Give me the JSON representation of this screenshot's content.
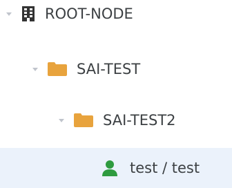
{
  "tree": {
    "nodes": [
      {
        "label": "ROOT-NODE",
        "icon": "building-icon",
        "expanded": true,
        "level": 0
      },
      {
        "label": "SAI-TEST",
        "icon": "folder-icon",
        "expanded": true,
        "level": 1
      },
      {
        "label": "SAI-TEST2",
        "icon": "folder-icon",
        "expanded": true,
        "level": 2
      },
      {
        "label": "test / test",
        "icon": "user-icon",
        "selected": true,
        "level": 3
      }
    ]
  },
  "colors": {
    "folder": "#e8a33d",
    "building": "#333333",
    "user": "#2e9b3f",
    "caret": "#c0c4cc",
    "selected_bg": "#ebf2fb"
  }
}
